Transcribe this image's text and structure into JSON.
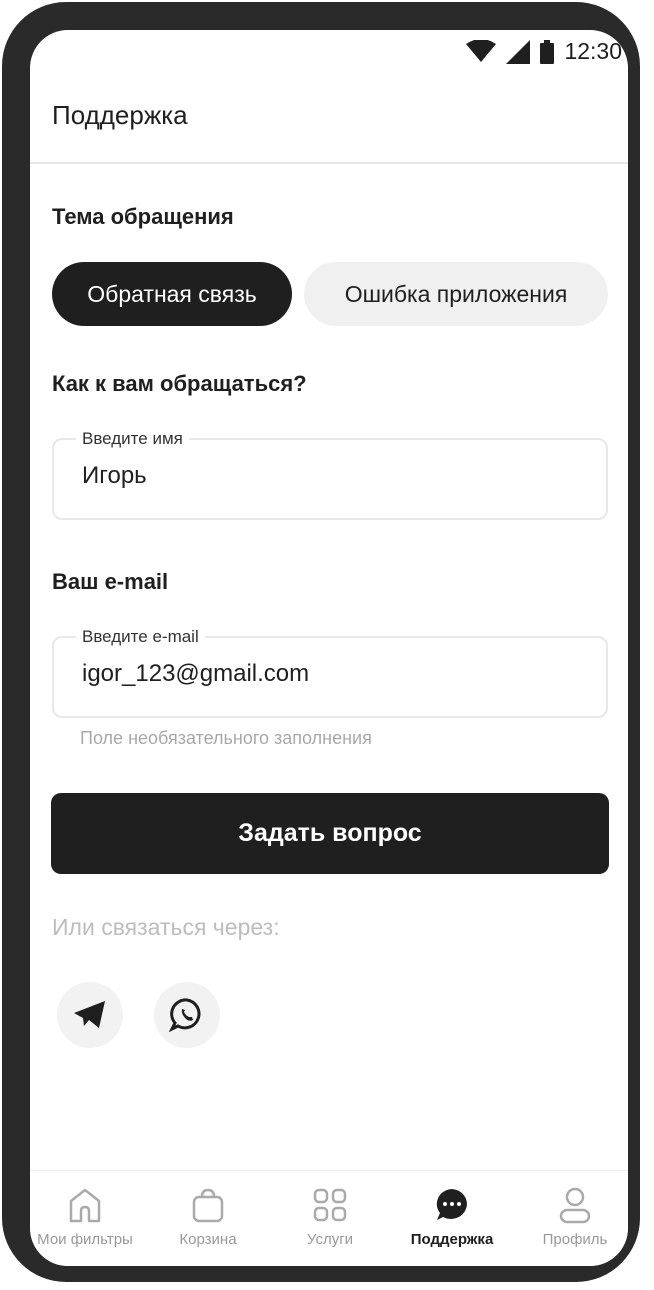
{
  "status_bar": {
    "time": "12:30"
  },
  "header": {
    "title": "Поддержка"
  },
  "topic": {
    "title": "Тема обращения",
    "options": [
      "Обратная связь",
      "Ошибка приложения"
    ],
    "selected": "Обратная связь"
  },
  "name_section": {
    "title": "Как к вам обращаться?",
    "label": "Введите имя",
    "value": "Игорь"
  },
  "email_section": {
    "title": "Ваш e-mail",
    "label": "Введите e-mail",
    "value": "igor_123@gmail.com",
    "hint": "Поле необязательного заполнения"
  },
  "submit_label": "Задать вопрос",
  "contact": {
    "label": "Или связаться через:",
    "icons": [
      "telegram-icon",
      "whatsapp-icon"
    ]
  },
  "tabbar": {
    "items": [
      {
        "label": "Мои фильтры",
        "icon": "home-icon"
      },
      {
        "label": "Корзина",
        "icon": "bag-icon"
      },
      {
        "label": "Услуги",
        "icon": "grid-icon"
      },
      {
        "label": "Поддержка",
        "icon": "chat-icon",
        "active": true
      },
      {
        "label": "Профиль",
        "icon": "profile-icon"
      }
    ]
  },
  "colors": {
    "primary": "#1f1f1f",
    "chip_inactive": "#f0f0f0",
    "hint": "#a8a8a8",
    "muted": "#999999"
  }
}
